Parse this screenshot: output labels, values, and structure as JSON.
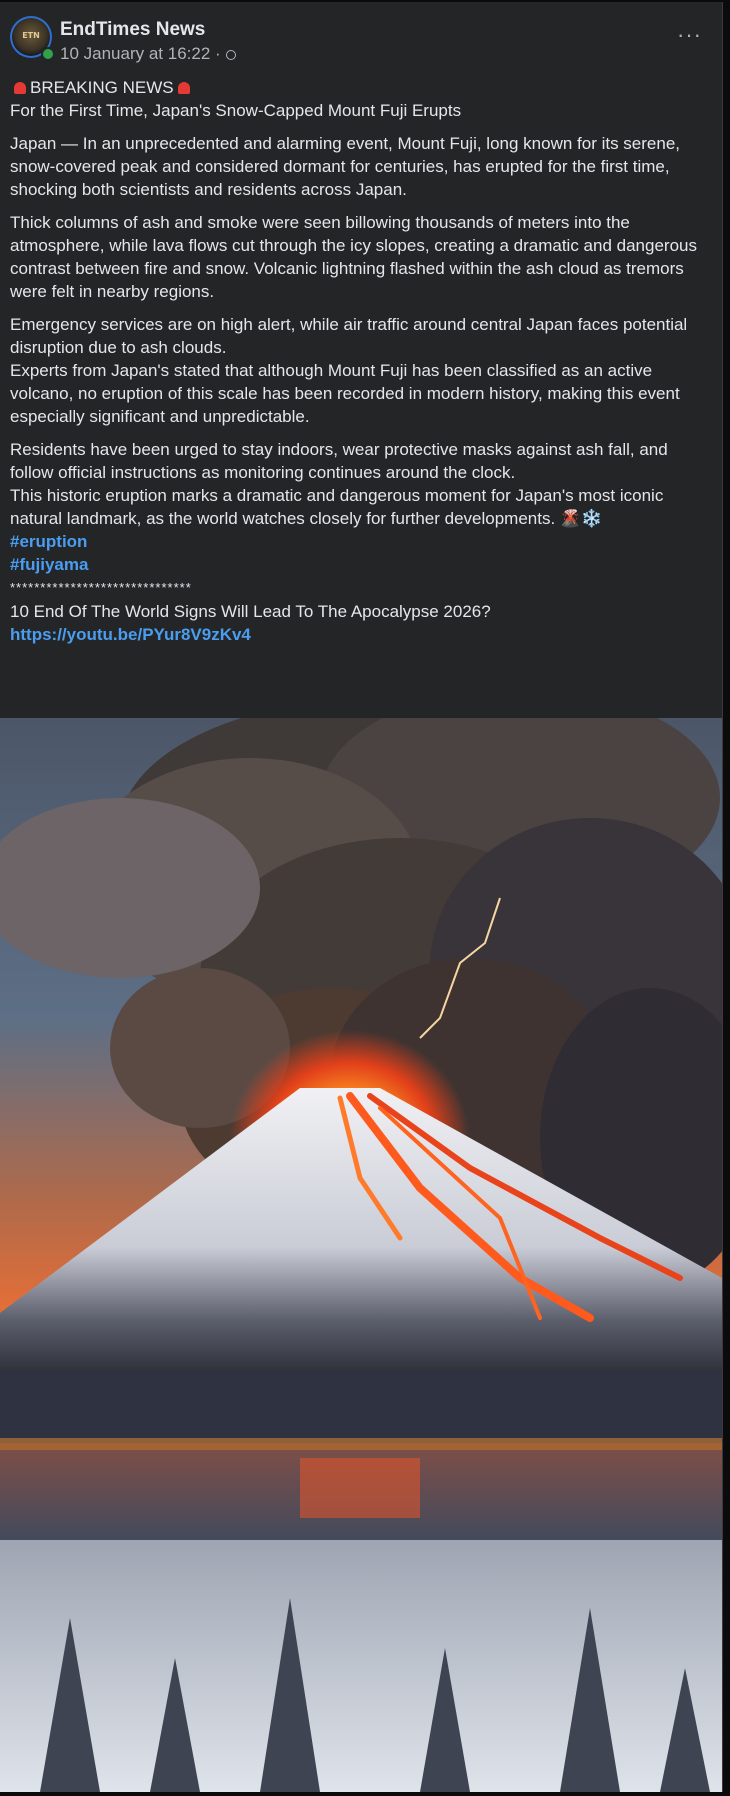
{
  "post": {
    "page_name": "EndTimes News",
    "avatar_text": "ETN",
    "timestamp": "10 January at 16:22 ·",
    "more_label": "···",
    "headline_label": "BREAKING NEWS",
    "subheadline": "For the First Time, Japan's Snow-Capped Mount Fuji Erupts",
    "paragraph_1": "Japan — In an unprecedented and alarming event, Mount Fuji, long known for its serene, snow-covered peak and considered dormant for centuries, has erupted for the first time, shocking both scientists and residents across Japan.",
    "paragraph_2": "Thick columns of ash and smoke were seen billowing thousands of meters into the atmosphere, while lava flows cut through the icy slopes, creating a dramatic and dangerous contrast between fire and snow. Volcanic lightning flashed within the ash cloud as tremors were felt in nearby regions.",
    "paragraph_3a": " Emergency services are on high alert, while air traffic around central Japan faces potential disruption due to ash clouds.",
    "paragraph_3b": "Experts from Japan's stated that although Mount Fuji has been classified as an active volcano, no eruption of this scale has been recorded in modern history, making this event especially significant and unpredictable.",
    "paragraph_4a": "Residents have been urged to stay indoors, wear protective masks against ash fall, and follow official instructions as monitoring continues around the clock.",
    "paragraph_4b": "This historic eruption marks a dramatic and dangerous moment for Japan's most iconic natural landmark, as the world watches closely for further developments. 🌋❄️",
    "hashtag_1": "#eruption",
    "hashtag_2": "#fujiyama",
    "separator": "******************************",
    "promo_text": "10 End Of The World Signs Will Lead To The Apocalypse 2026?",
    "promo_link": "https://youtu.be/PYur8V9zKv4"
  },
  "colors": {
    "card_bg": "#242526",
    "text_primary": "#e4e6eb",
    "text_secondary": "#b0b3b8",
    "link": "#4a9df0",
    "online": "#31a24c"
  }
}
